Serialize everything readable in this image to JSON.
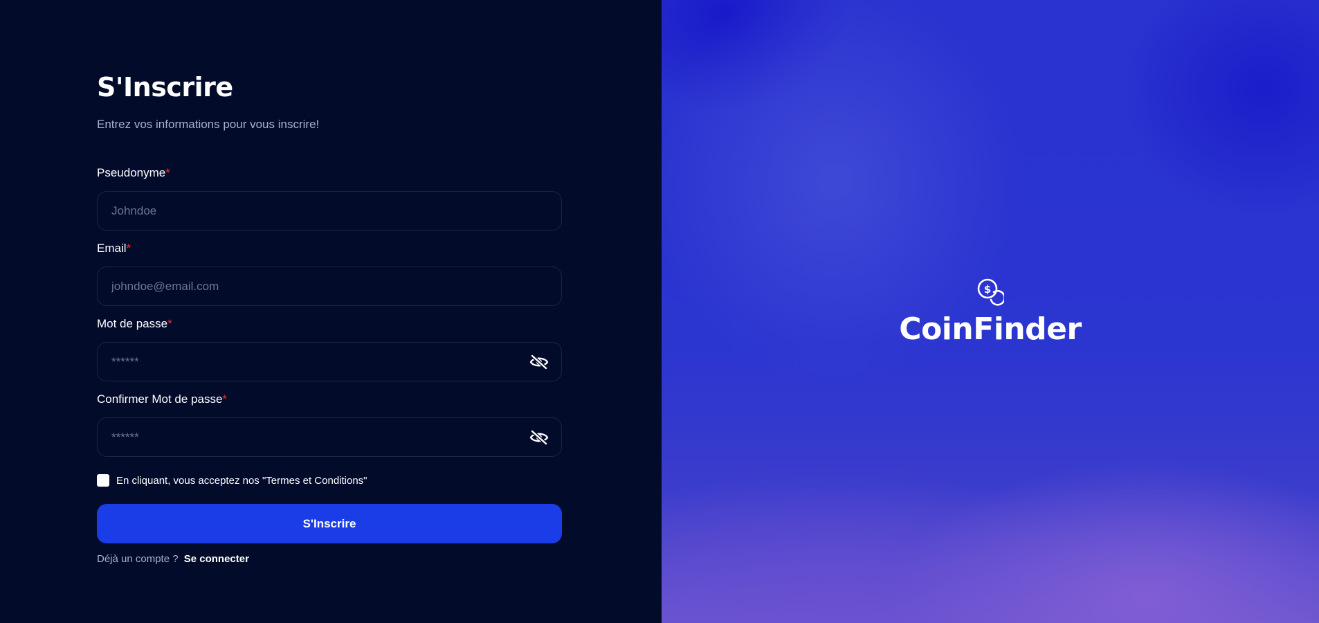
{
  "form": {
    "title": "S'Inscrire",
    "subtitle": "Entrez vos informations pour vous inscrire!",
    "required_mark": "*",
    "fields": [
      {
        "label": "Pseudonyme",
        "placeholder": "Johndoe",
        "value": ""
      },
      {
        "label": "Email",
        "placeholder": "johndoe@email.com",
        "value": ""
      },
      {
        "label": "Mot de passe",
        "placeholder": "******",
        "value": "",
        "icon": "eye-off-icon"
      },
      {
        "label": "Confirmer Mot de passe",
        "placeholder": "******",
        "value": "",
        "icon": "eye-off-icon"
      }
    ],
    "terms_text": "En cliquant, vous acceptez nos \"Termes et Conditions\"",
    "terms_checked": false,
    "submit_label": "S'Inscrire",
    "login_prompt": "Déjà un compte ?",
    "login_link": "Se connecter"
  },
  "brand": {
    "name": "CoinFinder",
    "icon": "coins-icon"
  },
  "colors": {
    "background": "#030b2b",
    "accent": "#1a3de8",
    "required": "#ff2b2b",
    "panel_gradient_start": "#2a32cf",
    "panel_gradient_end": "#6a55cf"
  }
}
